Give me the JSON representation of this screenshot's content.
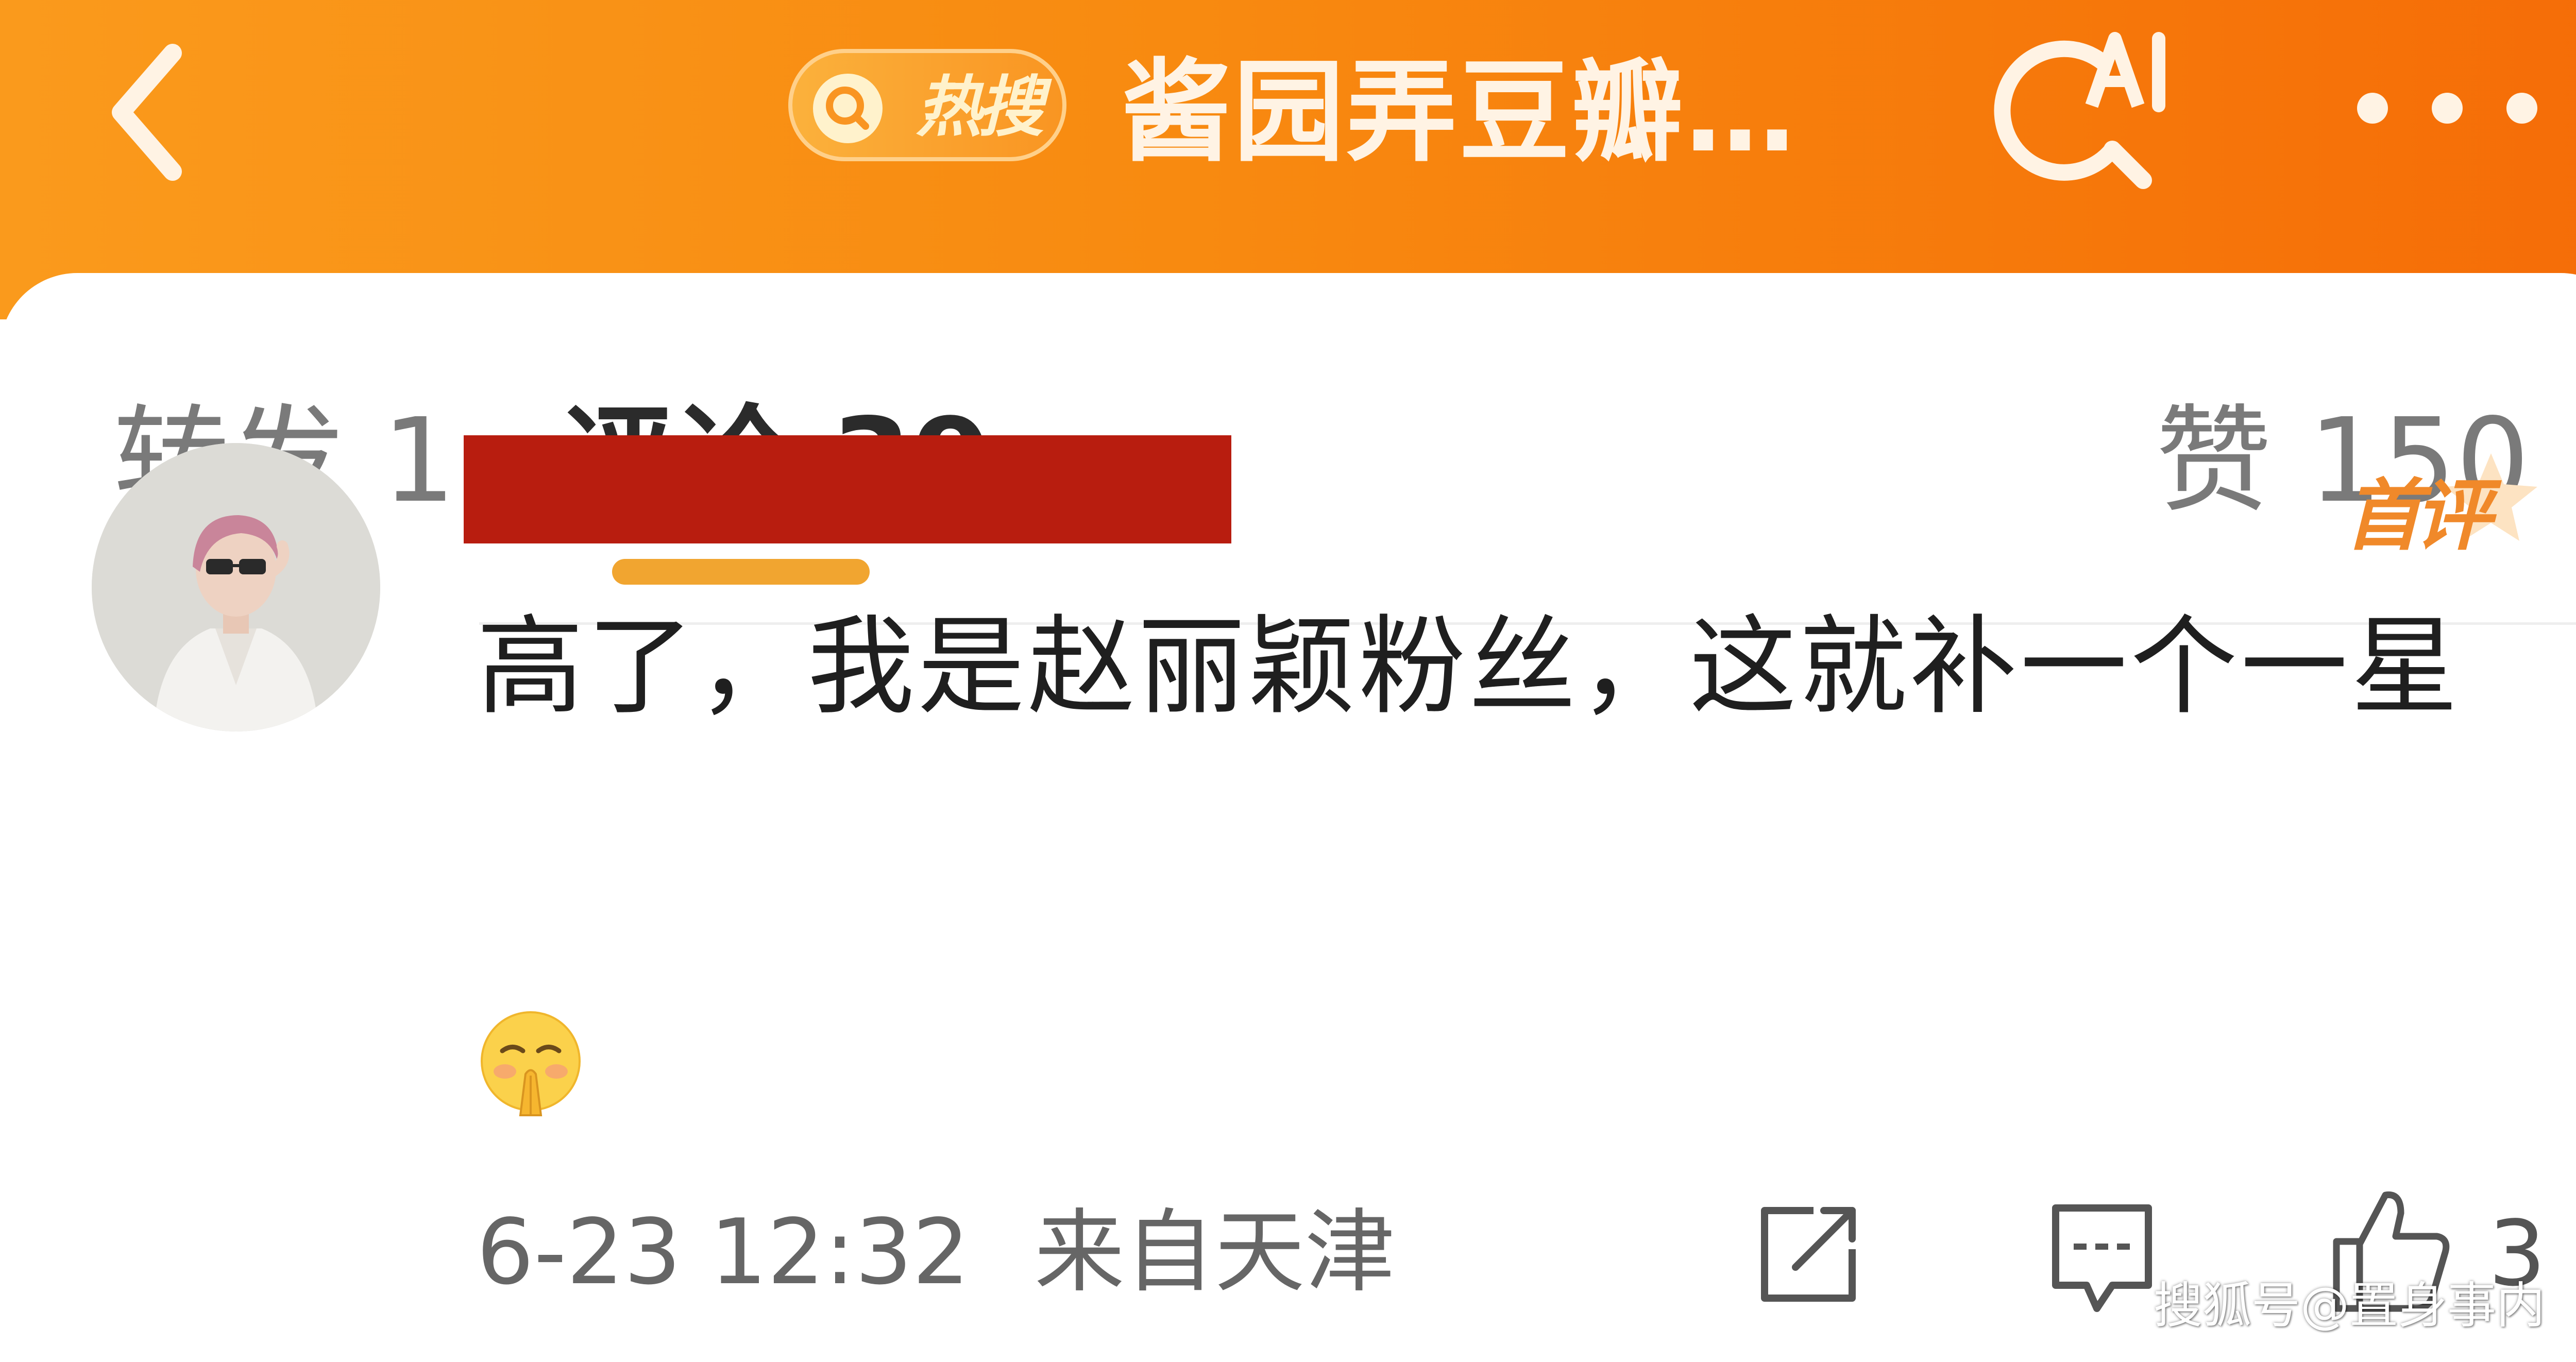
{
  "header": {
    "back_icon": "chevron-left-icon",
    "hot_search_label": "热搜",
    "hot_search_icon": "search-icon",
    "title": "酱园弄豆瓣…",
    "ai_search_icon": "ai-search-icon",
    "more_icon": "more-dots-icon",
    "gradient_colors": [
      "#fa9a1c",
      "#f56c07"
    ]
  },
  "tabs": {
    "forward_label": "转发 1",
    "comments_label": "评论 39",
    "likes_label": "赞 150",
    "active": "comments",
    "accent_color": "#f1a530"
  },
  "comment": {
    "avatar": "user-avatar",
    "username_redacted": true,
    "first_comment_badge": "首评",
    "text": "高了，我是赵丽颖粉丝，这就补一个一星",
    "emoji": "pleading-hands-emoji",
    "timestamp": "6-23 12:32",
    "location": "来自天津",
    "like_count": "3"
  },
  "watermark": {
    "text": "搜狐号@置身事内"
  }
}
